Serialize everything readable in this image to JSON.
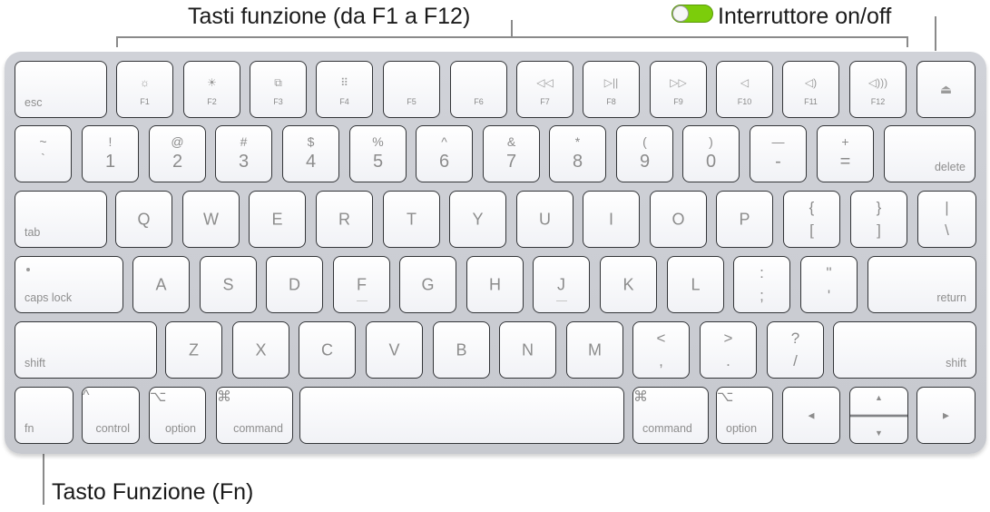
{
  "callouts": {
    "function_keys": "Tasti funzione (da F1 a F12)",
    "power_switch": "Interruttore on/off",
    "fn_key": "Tasto Funzione (Fn)"
  },
  "toggle": {
    "state": "on",
    "color_on": "#7ccd0b"
  },
  "row_function": [
    {
      "label": "esc"
    },
    {
      "label": "F1",
      "icon": "☼",
      "icon_name": "brightness-down-icon"
    },
    {
      "label": "F2",
      "icon": "☀",
      "icon_name": "brightness-up-icon"
    },
    {
      "label": "F3",
      "icon": "⧉",
      "icon_name": "mission-control-icon"
    },
    {
      "label": "F4",
      "icon": "⠿",
      "icon_name": "launchpad-icon"
    },
    {
      "label": "F5"
    },
    {
      "label": "F6"
    },
    {
      "label": "F7",
      "icon": "◁◁",
      "icon_name": "rewind-icon"
    },
    {
      "label": "F8",
      "icon": "▷||",
      "icon_name": "play-pause-icon"
    },
    {
      "label": "F9",
      "icon": "▷▷",
      "icon_name": "fast-forward-icon"
    },
    {
      "label": "F10",
      "icon": "◁",
      "icon_name": "mute-icon"
    },
    {
      "label": "F11",
      "icon": "◁)",
      "icon_name": "volume-down-icon"
    },
    {
      "label": "F12",
      "icon": "◁)))",
      "icon_name": "volume-up-icon"
    },
    {
      "label": "",
      "icon": "⏏",
      "icon_name": "eject-icon"
    }
  ],
  "row_number": [
    {
      "top": "~",
      "bot": "`"
    },
    {
      "top": "!",
      "bot": "1"
    },
    {
      "top": "@",
      "bot": "2"
    },
    {
      "top": "#",
      "bot": "3"
    },
    {
      "top": "$",
      "bot": "4"
    },
    {
      "top": "%",
      "bot": "5"
    },
    {
      "top": "^",
      "bot": "6"
    },
    {
      "top": "&",
      "bot": "7"
    },
    {
      "top": "*",
      "bot": "8"
    },
    {
      "top": "(",
      "bot": "9"
    },
    {
      "top": ")",
      "bot": "0"
    },
    {
      "top": "—",
      "bot": "-"
    },
    {
      "top": "+",
      "bot": "="
    },
    {
      "label": "delete"
    }
  ],
  "row_qwerty": {
    "tab": "tab",
    "letters": [
      "Q",
      "W",
      "E",
      "R",
      "T",
      "Y",
      "U",
      "I",
      "O",
      "P"
    ],
    "brackets": [
      {
        "top": "{",
        "bot": "["
      },
      {
        "top": "}",
        "bot": "]"
      },
      {
        "top": "|",
        "bot": "\\"
      }
    ]
  },
  "row_home": {
    "caps": "caps lock",
    "letters": [
      "A",
      "S",
      "D",
      "F",
      "G",
      "H",
      "J",
      "K",
      "L"
    ],
    "punct": [
      {
        "top": ":",
        "bot": ";"
      },
      {
        "top": "\"",
        "bot": "'"
      }
    ],
    "return": "return"
  },
  "row_shift": {
    "shift_left": "shift",
    "letters": [
      "Z",
      "X",
      "C",
      "V",
      "B",
      "N",
      "M"
    ],
    "punct": [
      {
        "top": "<",
        "bot": ","
      },
      {
        "top": ">",
        "bot": "."
      },
      {
        "top": "?",
        "bot": "/"
      }
    ],
    "shift_right": "shift"
  },
  "row_bottom": {
    "fn": "fn",
    "control": {
      "label": "control",
      "glyph": "^"
    },
    "option_left": {
      "label": "option",
      "glyph": "⌥"
    },
    "command_left": {
      "label": "command",
      "glyph": "⌘"
    },
    "command_right": {
      "label": "command",
      "glyph": "⌘"
    },
    "option_right": {
      "label": "option",
      "glyph": "⌥"
    },
    "arrows": {
      "left": "◀",
      "up": "▲",
      "down": "▼",
      "right": "▶"
    }
  }
}
